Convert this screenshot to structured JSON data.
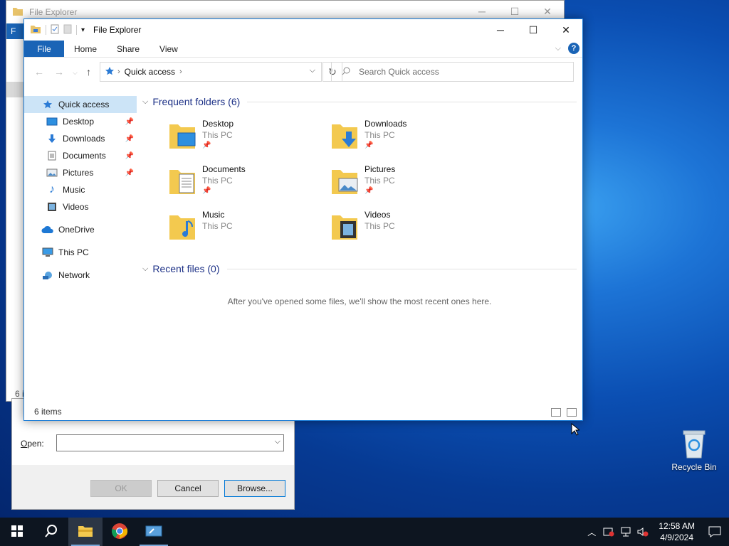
{
  "desktop": {
    "recycle_bin_label": "Recycle Bin"
  },
  "run_dialog": {
    "open_label_prefix": "",
    "open_label_underlined": "O",
    "open_label_rest": "pen:",
    "open_value": "",
    "buttons": {
      "ok": "OK",
      "cancel": "Cancel",
      "browse": "Browse..."
    }
  },
  "back_window": {
    "title": "File Explorer",
    "file_tab": "F",
    "status": "6 i"
  },
  "window": {
    "title": "File Explorer",
    "ribbon_tabs": [
      "File",
      "Home",
      "Share",
      "View"
    ],
    "help_label": "?",
    "address_location": "Quick access",
    "search_placeholder": "Search Quick access",
    "status_text": "6 items"
  },
  "sidebar": {
    "items": [
      {
        "label": "Quick access",
        "icon": "star-icon",
        "pinned": false,
        "selected": true
      },
      {
        "label": "Desktop",
        "icon": "desktop-icon",
        "pinned": true
      },
      {
        "label": "Downloads",
        "icon": "download-icon",
        "pinned": true
      },
      {
        "label": "Documents",
        "icon": "document-icon",
        "pinned": true
      },
      {
        "label": "Pictures",
        "icon": "picture-icon",
        "pinned": true
      },
      {
        "label": "Music",
        "icon": "music-icon",
        "pinned": false
      },
      {
        "label": "Videos",
        "icon": "video-icon",
        "pinned": false
      },
      {
        "label": "OneDrive",
        "icon": "cloud-icon",
        "pinned": false
      },
      {
        "label": "This PC",
        "icon": "computer-icon",
        "pinned": false
      },
      {
        "label": "Network",
        "icon": "network-icon",
        "pinned": false
      }
    ]
  },
  "frequent": {
    "header": "Frequent folders (6)",
    "folders": [
      {
        "name": "Desktop",
        "location": "This PC",
        "pinned": true,
        "overlay": "desktop-icon"
      },
      {
        "name": "Downloads",
        "location": "This PC",
        "pinned": true,
        "overlay": "download-icon"
      },
      {
        "name": "Documents",
        "location": "This PC",
        "pinned": true,
        "overlay": "document-icon"
      },
      {
        "name": "Pictures",
        "location": "This PC",
        "pinned": true,
        "overlay": "picture-icon"
      },
      {
        "name": "Music",
        "location": "This PC",
        "pinned": false,
        "overlay": "music-icon"
      },
      {
        "name": "Videos",
        "location": "This PC",
        "pinned": false,
        "overlay": "video-icon"
      }
    ]
  },
  "recent": {
    "header": "Recent files (0)",
    "empty_message": "After you've opened some files, we'll show the most recent ones here."
  },
  "taskbar": {
    "time": "12:58 AM",
    "date": "4/9/2024"
  },
  "colors": {
    "accent": "#1a64b6",
    "selection": "#cce4f7",
    "folder": "#f3c94f",
    "taskbar": "#0d1520"
  }
}
